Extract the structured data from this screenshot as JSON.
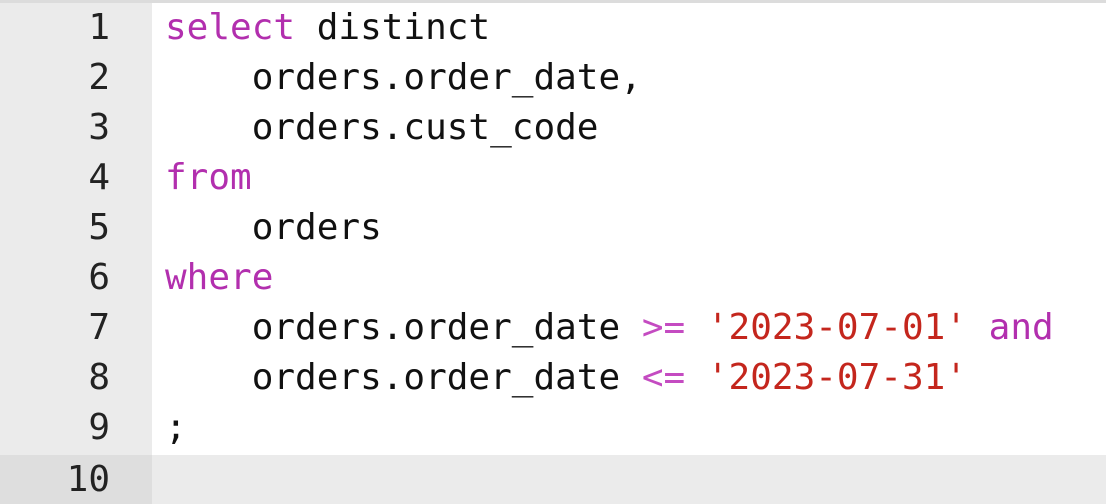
{
  "editor": {
    "colors": {
      "keyword": "#b22fae",
      "operator": "#c44bc1",
      "string": "#c4261d",
      "text": "#111111",
      "gutter": "#ebebeb",
      "active_line": "#ebebeb"
    },
    "active_line": 10,
    "lines": [
      {
        "number": "1",
        "tokens": [
          {
            "t": "kw",
            "v": "select"
          },
          {
            "t": "txt",
            "v": " distinct"
          }
        ]
      },
      {
        "number": "2",
        "tokens": [
          {
            "t": "txt",
            "v": "    orders.order_date,"
          }
        ]
      },
      {
        "number": "3",
        "tokens": [
          {
            "t": "txt",
            "v": "    orders.cust_code"
          }
        ]
      },
      {
        "number": "4",
        "tokens": [
          {
            "t": "kw",
            "v": "from"
          }
        ]
      },
      {
        "number": "5",
        "tokens": [
          {
            "t": "txt",
            "v": "    orders"
          }
        ]
      },
      {
        "number": "6",
        "tokens": [
          {
            "t": "kw",
            "v": "where"
          }
        ]
      },
      {
        "number": "7",
        "tokens": [
          {
            "t": "txt",
            "v": "    orders.order_date "
          },
          {
            "t": "op",
            "v": ">="
          },
          {
            "t": "txt",
            "v": " "
          },
          {
            "t": "str",
            "v": "'2023-07-01'"
          },
          {
            "t": "txt",
            "v": " "
          },
          {
            "t": "kw",
            "v": "and"
          }
        ]
      },
      {
        "number": "8",
        "tokens": [
          {
            "t": "txt",
            "v": "    orders.order_date "
          },
          {
            "t": "op",
            "v": "<="
          },
          {
            "t": "txt",
            "v": " "
          },
          {
            "t": "str",
            "v": "'2023-07-31'"
          }
        ]
      },
      {
        "number": "9",
        "tokens": [
          {
            "t": "txt",
            "v": ";"
          }
        ]
      },
      {
        "number": "10",
        "tokens": []
      }
    ]
  }
}
